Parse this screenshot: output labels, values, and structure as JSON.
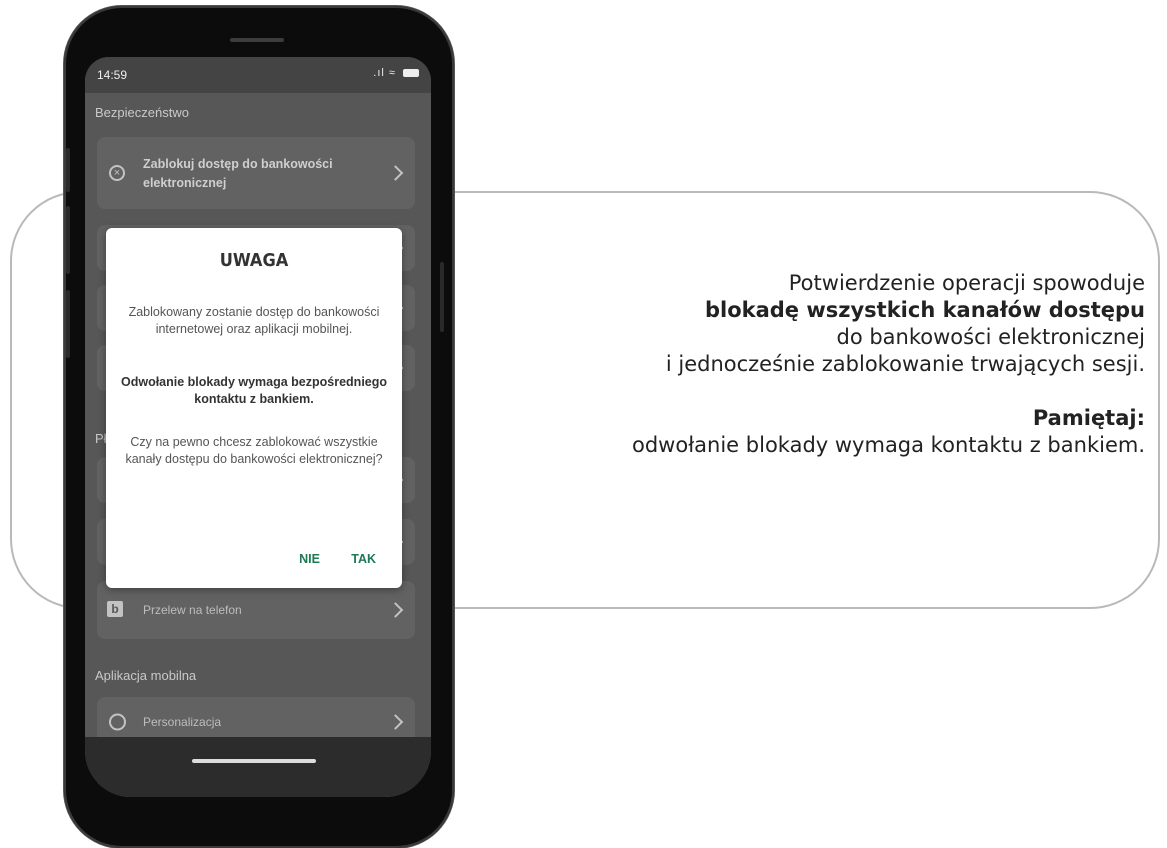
{
  "status_bar": {
    "time": "14:59",
    "signal": ".ıl",
    "wifi": "≈"
  },
  "sections": {
    "security": "Bezpieczeństwo",
    "payments_partial": "Pł",
    "mobile_app": "Aplikacja mobilna"
  },
  "cards": {
    "block_access": "Zablokuj dostęp do bankowości elektronicznej",
    "phone_transfer": "Przelew na telefon",
    "personalization": "Personalizacja"
  },
  "dialog": {
    "title": "UWAGA",
    "message_1": "Zablokowany zostanie dostęp do bankowości internetowej oraz aplikacji mobilnej.",
    "message_2": "Odwołanie blokady wymaga bezpośredniego kontaktu z bankiem.",
    "message_3": "Czy na pewno chcesz zablokować wszystkie kanały dostępu do bankowości elektronicznej?",
    "btn_no": "NIE",
    "btn_yes": "TAK"
  },
  "callout": {
    "line1": "Potwierdzenie operacji spowoduje",
    "line2_bold": "blokadę wszystkich kanałów dostępu",
    "line3": "do bankowości elektronicznej",
    "line4": "i jednocześnie zablokowanie trwających sesji.",
    "remember_bold": "Pamiętaj:",
    "line6": "odwołanie blokady wymaga kontaktu z bankiem."
  },
  "icons": {
    "block": "x-circle-icon",
    "blik": "blik-icon",
    "user": "user-circle-icon",
    "chevron": "chevron-right-icon"
  }
}
